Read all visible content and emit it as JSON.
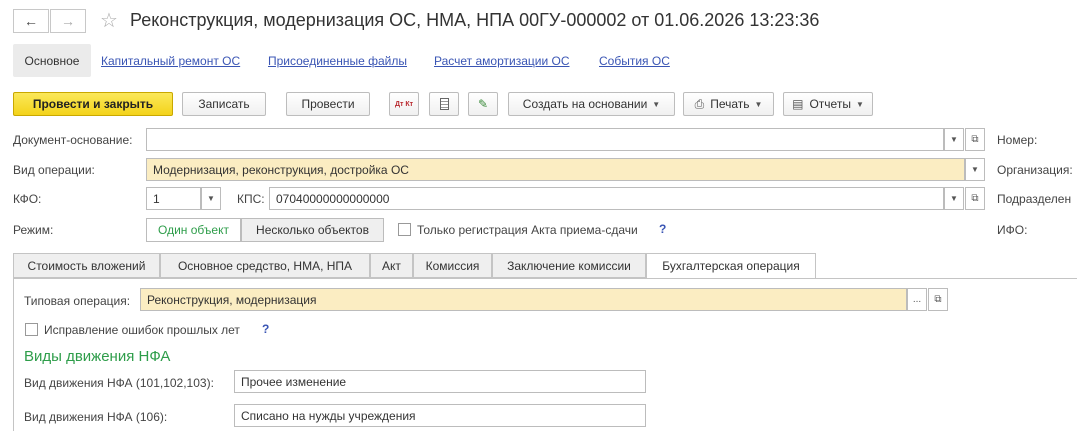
{
  "window": {
    "title": "Реконструкция, модернизация ОС, НМА, НПА 00ГУ-000002 от 01.06.2026 13:23:36"
  },
  "nav_tabs": {
    "active": "Основное",
    "links": [
      "Капитальный ремонт ОС",
      "Присоединенные файлы",
      "Расчет амортизации ОС",
      "События ОС"
    ]
  },
  "toolbar": {
    "post_close": "Провести и закрыть",
    "save": "Записать",
    "post": "Провести",
    "create_based": "Создать на основании",
    "print": "Печать",
    "reports": "Отчеты",
    "dtkt_icon_text": "Дт Кт"
  },
  "form": {
    "doc_basis_label": "Документ-основание:",
    "doc_basis_value": "",
    "operation_label": "Вид операции:",
    "operation_value": "Модернизация, реконструкция, достройка ОС",
    "kfo_label": "КФО:",
    "kfo_value": "1",
    "kps_label": "КПС:",
    "kps_value": "07040000000000000",
    "mode_label": "Режим:",
    "mode_single": "Один объект",
    "mode_multi": "Несколько объектов",
    "act_only_label": "Только регистрация Акта приема-сдачи",
    "help": "?",
    "right_labels": [
      "Номер:",
      "Организация:",
      "Подразделен",
      "ИФО:"
    ]
  },
  "page_tabs": [
    "Стоимость вложений",
    "Основное средство, НМА, НПА",
    "Акт",
    "Комиссия",
    "Заключение комиссии",
    "Бухгалтерская операция"
  ],
  "panel": {
    "typical_op_label": "Типовая операция:",
    "typical_op_value": "Реконструкция, модернизация",
    "correction_label": "Исправление ошибок прошлых лет",
    "section_title": "Виды движения НФА",
    "movement1_label": "Вид движения НФА (101,102,103):",
    "movement1_value": "Прочее изменение",
    "movement2_label": "Вид движения НФА (106):",
    "movement2_value": "Списано на нужды учреждения",
    "ellipsis": "..."
  },
  "colors": {
    "primary_button": "#f3d31a",
    "required_field": "#fbedc2",
    "link": "#3a55b4",
    "section_title": "#2e9d4a"
  }
}
